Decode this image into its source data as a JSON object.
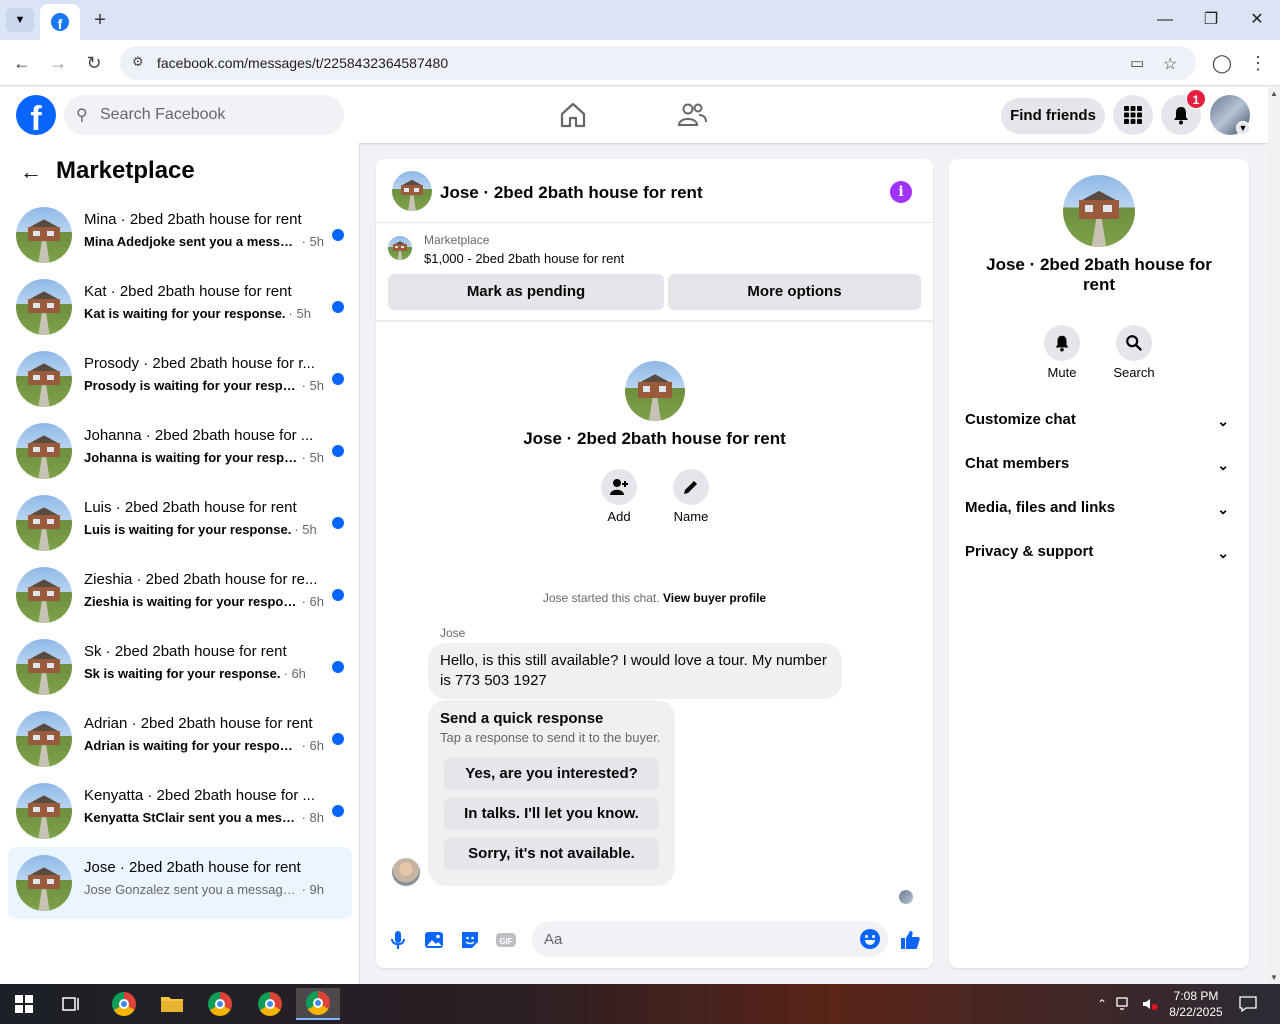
{
  "browser": {
    "url": "facebook.com/messages/t/2258432364587480"
  },
  "header": {
    "search_placeholder": "Search Facebook",
    "find_friends": "Find friends",
    "notif_count": "1"
  },
  "sidebar": {
    "title": "Marketplace",
    "conversations": [
      {
        "name": "Mina · 2bed 2bath house for rent",
        "text": "Mina Adedjoke sent you a messag...",
        "time": "· 5h",
        "unread": true
      },
      {
        "name": "Kat · 2bed 2bath house for rent",
        "text": "Kat is waiting for your response.",
        "time": "· 5h",
        "unread": true
      },
      {
        "name": "Prosody · 2bed 2bath house for r...",
        "text": "Prosody is waiting for your respon...",
        "time": "· 5h",
        "unread": true
      },
      {
        "name": "Johanna · 2bed 2bath house for ...",
        "text": "Johanna is waiting for your respon...",
        "time": "· 5h",
        "unread": true
      },
      {
        "name": "Luis · 2bed 2bath house for rent",
        "text": "Luis is waiting for your response.",
        "time": "· 5h",
        "unread": true
      },
      {
        "name": "Zieshia · 2bed 2bath house for re...",
        "text": "Zieshia is waiting for your response.",
        "time": "· 6h",
        "unread": true
      },
      {
        "name": "Sk · 2bed 2bath house for rent",
        "text": "Sk is waiting for your response.",
        "time": "· 6h",
        "unread": true
      },
      {
        "name": "Adrian · 2bed 2bath house for rent",
        "text": "Adrian is waiting for your response.",
        "time": "· 6h",
        "unread": true
      },
      {
        "name": "Kenyatta · 2bed 2bath house for ...",
        "text": "Kenyatta StClair sent you a messag...",
        "time": "· 8h",
        "unread": true
      },
      {
        "name": "Jose · 2bed 2bath house for rent",
        "text": "Jose Gonzalez sent you a message ab...",
        "time": "· 9h",
        "unread": false
      }
    ]
  },
  "chat": {
    "title": "Jose · 2bed 2bath house for rent",
    "listing_category": "Marketplace",
    "listing_price": "$1,000 - 2bed 2bath house for rent",
    "mark_pending": "Mark as pending",
    "more_options": "More options",
    "center_name": "Jose · 2bed 2bath house for rent",
    "add_label": "Add",
    "name_label": "Name",
    "started_text": "Jose started this chat.",
    "view_buyer": "View buyer profile",
    "sender": "Jose",
    "message": "Hello, is this still available? I would love a tour. My number is 773 503 1927",
    "quick_title": "Send a quick response",
    "quick_sub": "Tap a response to send it to the buyer.",
    "quick_options": [
      "Yes, are you interested?",
      "In talks. I'll let you know.",
      "Sorry, it's not available."
    ],
    "composer_placeholder": "Aa"
  },
  "right_panel": {
    "name": "Jose · 2bed 2bath house for rent",
    "mute": "Mute",
    "search": "Search",
    "sections": [
      "Customize chat",
      "Chat members",
      "Media, files and links",
      "Privacy & support"
    ]
  },
  "taskbar": {
    "time": "7:08 PM",
    "date": "8/22/2025"
  },
  "colors": {
    "brand": "#0866ff",
    "unread_dot": "#0866ff",
    "info_icon": "#a033ff",
    "badge": "#e41e3f"
  }
}
